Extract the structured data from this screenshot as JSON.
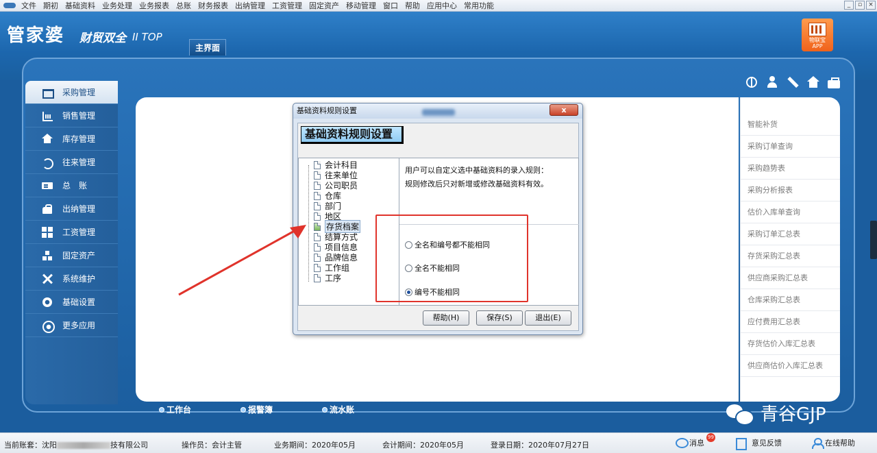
{
  "menu": {
    "items": [
      "文件",
      "期初",
      "基础资料",
      "业务处理",
      "业务报表",
      "总账",
      "财务报表",
      "出纳管理",
      "工资管理",
      "固定资产",
      "移动管理",
      "窗口",
      "帮助",
      "应用中心",
      "常用功能"
    ],
    "window_controls": [
      "_",
      "▫",
      "×"
    ]
  },
  "header": {
    "logo_main": "管家婆",
    "logo_sub": "财贸双全",
    "logo_version": "II TOP",
    "main_tab": "主界面",
    "app_badge_line1": "物联宝",
    "app_badge_line2": "APP"
  },
  "sidebar": {
    "items": [
      {
        "label": "采购管理",
        "icon": "cart-icon",
        "active": true
      },
      {
        "label": "销售管理",
        "icon": "chart-icon"
      },
      {
        "label": "库存管理",
        "icon": "home-icon"
      },
      {
        "label": "往来管理",
        "icon": "cycle-icon"
      },
      {
        "label": "总　账",
        "icon": "ledger-icon"
      },
      {
        "label": "出纳管理",
        "icon": "bag-icon"
      },
      {
        "label": "工资管理",
        "icon": "grid-icon"
      },
      {
        "label": "固定资产",
        "icon": "org-icon"
      },
      {
        "label": "系统维护",
        "icon": "tools-icon"
      },
      {
        "label": "基础设置",
        "icon": "gear-icon"
      },
      {
        "label": "更多应用",
        "icon": "target-icon"
      }
    ]
  },
  "right_list": {
    "items": [
      "智能补货",
      "采购订单查询",
      "采购趋势表",
      "采购分析报表",
      "估价入库单查询",
      "采购订单汇总表",
      "存货采购汇总表",
      "供应商采购汇总表",
      "仓库采购汇总表",
      "应付费用汇总表",
      "存货估价入库汇总表",
      "供应商估价入库汇总表"
    ]
  },
  "bottom_tabs": [
    "工作台",
    "报警簿",
    "流水账"
  ],
  "watermark": "青谷GJP",
  "dialog": {
    "title": "基础资料规则设置",
    "close_label": "x",
    "heading": "基础资料规则设置",
    "tree": [
      "会计科目",
      "往来单位",
      "公司职员",
      "仓库",
      "部门",
      "地区",
      "存货档案",
      "结算方式",
      "项目信息",
      "品牌信息",
      "工作组",
      "工序"
    ],
    "selected": "存货档案",
    "desc_line1": "用户可以自定义选中基础资料的录入规则：",
    "desc_line2": "规则修改后只对新增或修改基础资料有效。",
    "options": [
      {
        "label": "全名和编号都不能相同",
        "checked": false
      },
      {
        "label": "全名不能相同",
        "checked": false
      },
      {
        "label": "编号不能相同",
        "checked": true
      }
    ],
    "buttons": {
      "help": "帮助(H)",
      "save": "保存(S)",
      "exit": "退出(E)"
    }
  },
  "statusbar": {
    "account_prefix": "当前账套：沈阳",
    "account_suffix": "技有限公司",
    "operator": "操作员：会计主管",
    "business_period": "业务期间：2020年05月",
    "accounting_period": "会计期间：2020年05月",
    "login_date": "登录日期：2020年07月27日",
    "message": "消息",
    "message_count": "99",
    "feedback": "意见反馈",
    "online_help": "在线帮助"
  },
  "colors": {
    "brand_blue": "#1b5d9e",
    "annotation_red": "#e0332b",
    "badge_orange": "#f0621b"
  }
}
